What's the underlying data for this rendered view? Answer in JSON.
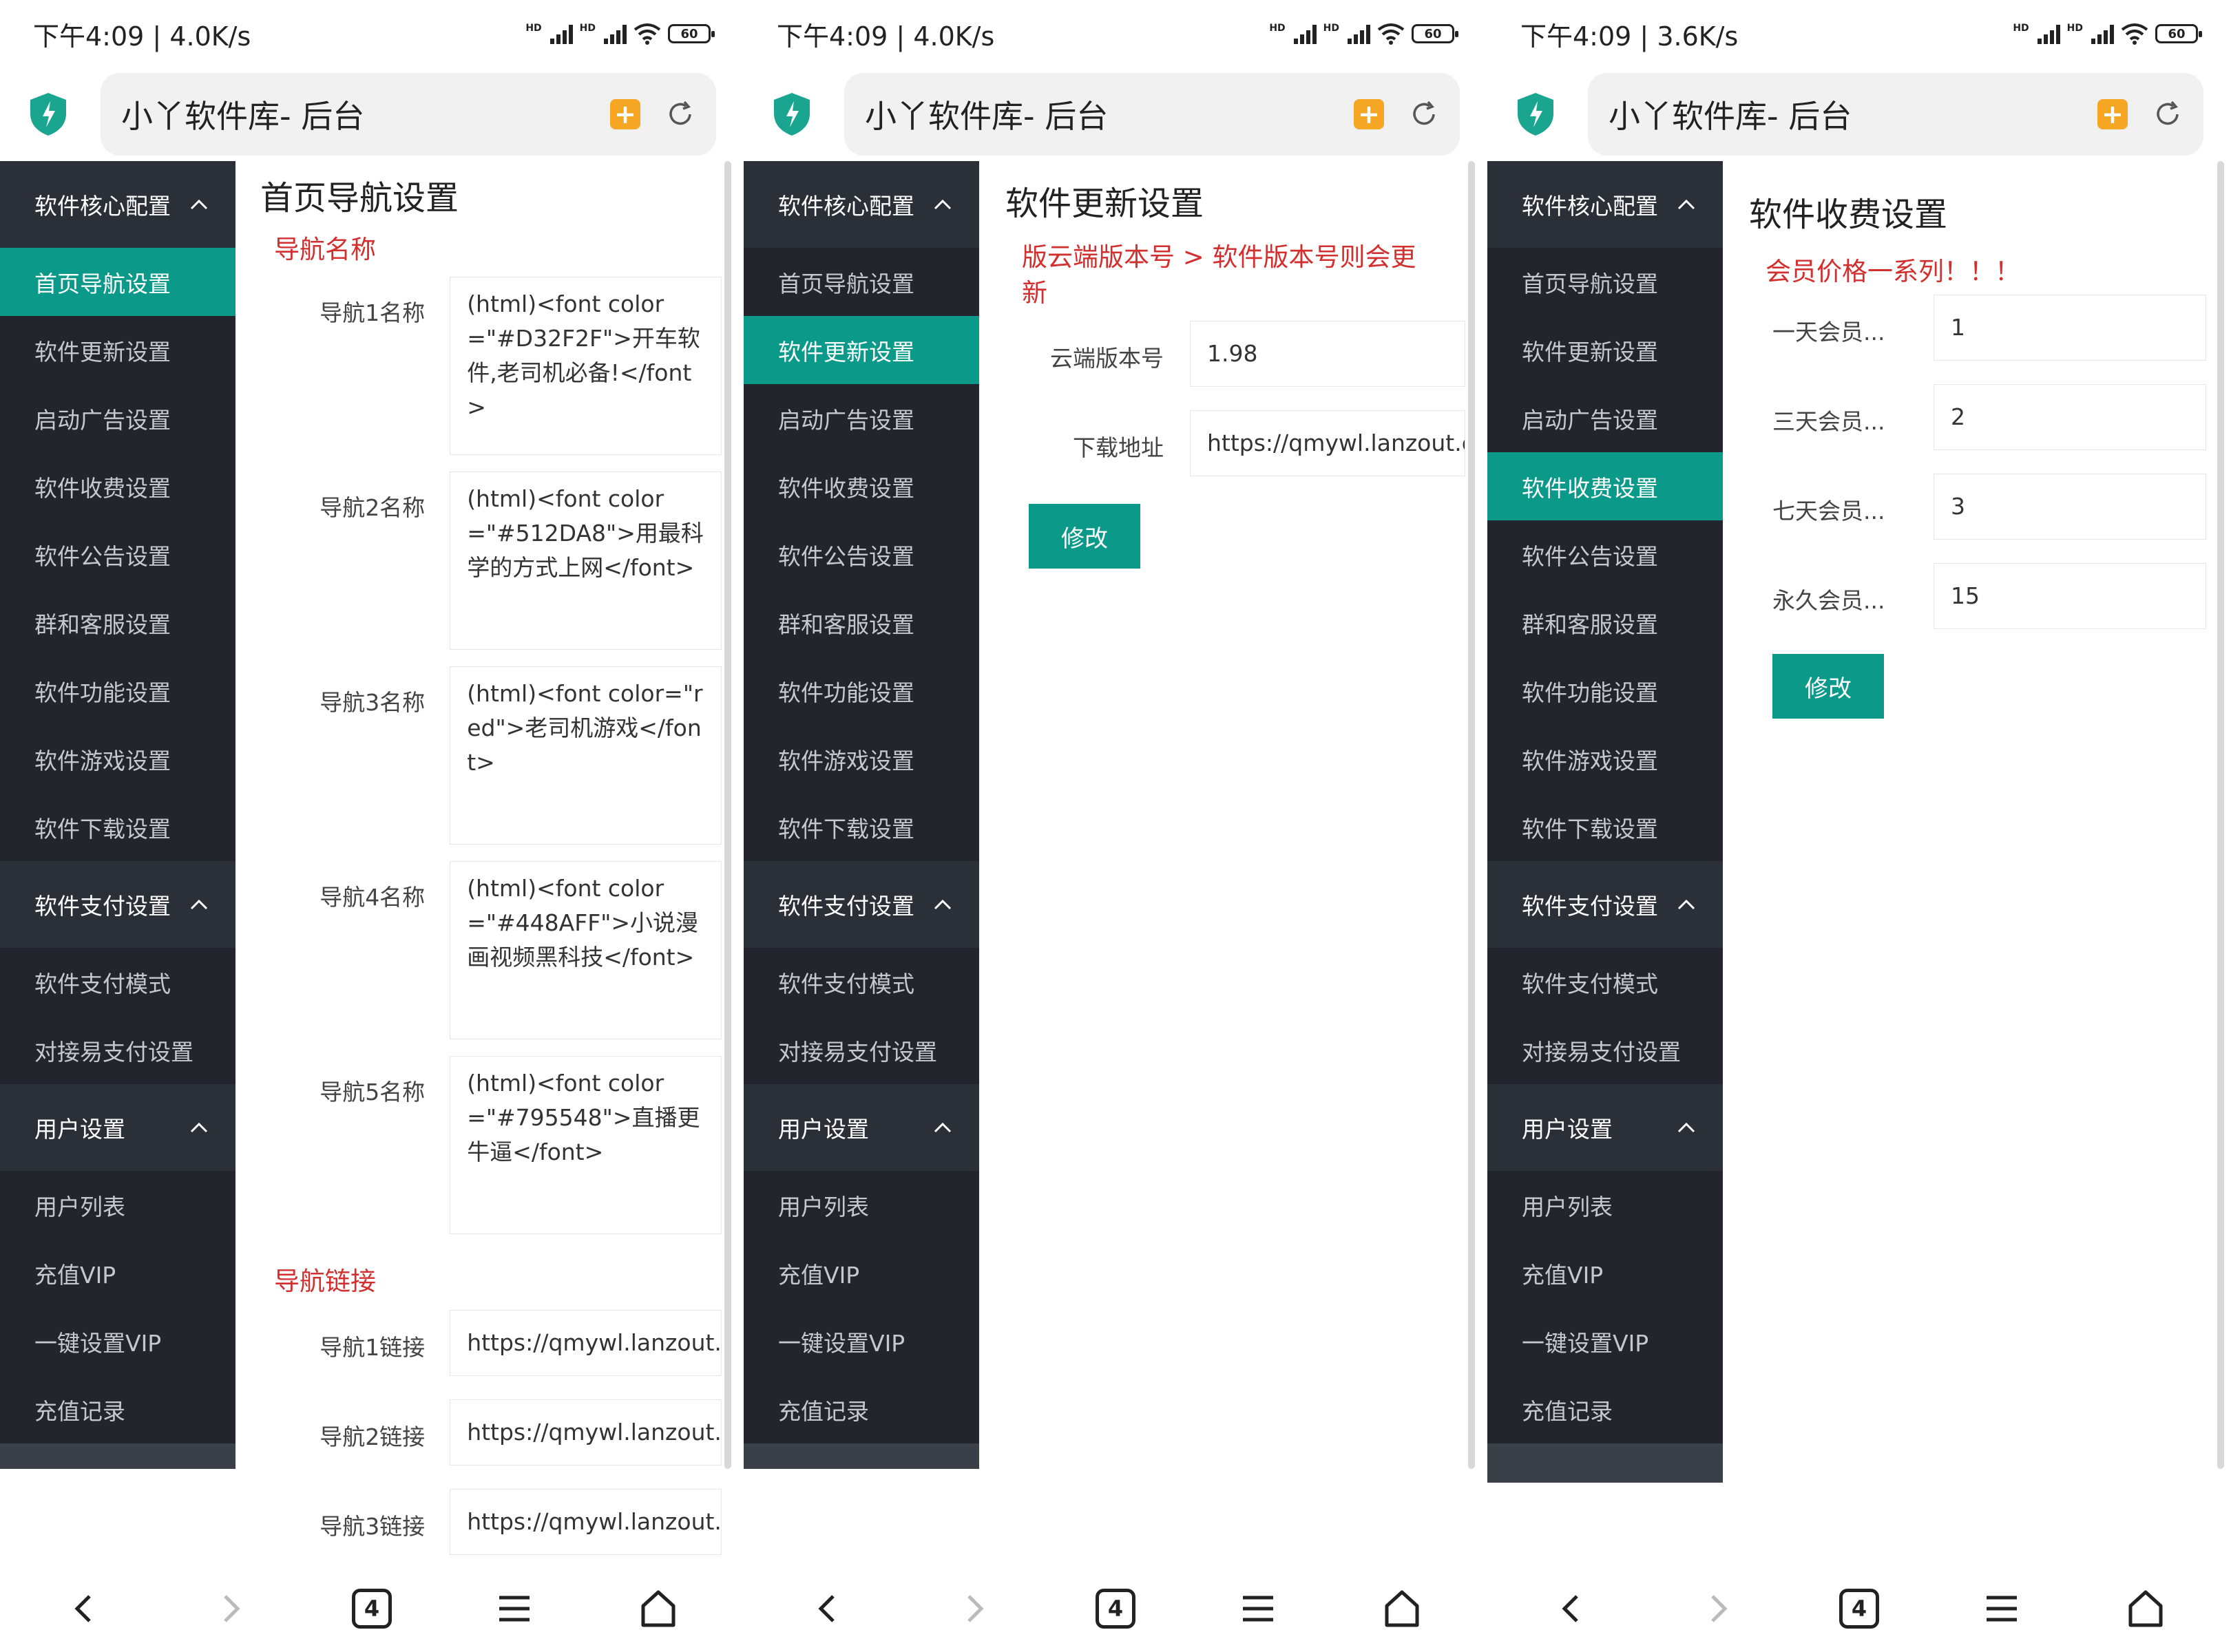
{
  "screens": [
    {
      "status": {
        "time": "下午4:09",
        "speed": "4.0K/s",
        "battery": "60"
      },
      "url_title": "小丫软件库- 后台",
      "sidebar": {
        "groups": [
          {
            "label": "软件核心配置",
            "items": [
              "首页导航设置",
              "软件更新设置",
              "启动广告设置",
              "软件收费设置",
              "软件公告设置",
              "群和客服设置",
              "软件功能设置",
              "软件游戏设置",
              "软件下载设置"
            ]
          },
          {
            "label": "软件支付设置",
            "items": [
              "软件支付模式",
              "对接易支付设置"
            ]
          },
          {
            "label": "用户设置",
            "items": [
              "用户列表",
              "充值VIP",
              "一键设置VIP",
              "充值记录"
            ]
          }
        ],
        "active": "首页导航设置"
      },
      "content": {
        "title": "首页导航设置",
        "section1": "导航名称",
        "names": [
          {
            "label": "导航1名称",
            "value": "(html)<font color=\"#D32F2F\">开车软件,老司机必备!</font>"
          },
          {
            "label": "导航2名称",
            "value": "(html)<font color=\"#512DA8\">用最科学的方式上网</font>"
          },
          {
            "label": "导航3名称",
            "value": "(html)<font color=\"red\">老司机游戏</font>"
          },
          {
            "label": "导航4名称",
            "value": "(html)<font color=\"#448AFF\">小说漫画视频黑科技</font>"
          },
          {
            "label": "导航5名称",
            "value": "(html)<font color=\"#795548\">直播更牛逼</font>"
          }
        ],
        "section2": "导航链接",
        "links": [
          {
            "label": "导航1链接",
            "value": "https://qmywl.lanzout.c"
          },
          {
            "label": "导航2链接",
            "value": "https://qmywl.lanzout.c"
          },
          {
            "label": "导航3链接",
            "value": "https://qmywl.lanzout.c"
          }
        ]
      }
    },
    {
      "status": {
        "time": "下午4:09",
        "speed": "4.0K/s",
        "battery": "60"
      },
      "url_title": "小丫软件库- 后台",
      "sidebar": {
        "groups": [
          {
            "label": "软件核心配置",
            "items": [
              "首页导航设置",
              "软件更新设置",
              "启动广告设置",
              "软件收费设置",
              "软件公告设置",
              "群和客服设置",
              "软件功能设置",
              "软件游戏设置",
              "软件下载设置"
            ]
          },
          {
            "label": "软件支付设置",
            "items": [
              "软件支付模式",
              "对接易支付设置"
            ]
          },
          {
            "label": "用户设置",
            "items": [
              "用户列表",
              "充值VIP",
              "一键设置VIP",
              "充值记录"
            ]
          }
        ],
        "active": "软件更新设置"
      },
      "content": {
        "title": "软件更新设置",
        "notice": "版云端版本号 > 软件版本号则会更新",
        "fields": [
          {
            "label": "云端版本号",
            "value": "1.98"
          },
          {
            "label": "下载地址",
            "value": "https://qmywl.lanzout.c"
          }
        ],
        "button": "修改"
      }
    },
    {
      "status": {
        "time": "下午4:09",
        "speed": "3.6K/s",
        "battery": "60"
      },
      "url_title": "小丫软件库- 后台",
      "sidebar": {
        "groups": [
          {
            "label": "软件核心配置",
            "items": [
              "首页导航设置",
              "软件更新设置",
              "启动广告设置",
              "软件收费设置",
              "软件公告设置",
              "群和客服设置",
              "软件功能设置",
              "软件游戏设置",
              "软件下载设置"
            ]
          },
          {
            "label": "软件支付设置",
            "items": [
              "软件支付模式",
              "对接易支付设置"
            ]
          },
          {
            "label": "用户设置",
            "items": [
              "用户列表",
              "充值VIP",
              "一键设置VIP",
              "充值记录"
            ]
          }
        ],
        "active": "软件收费设置"
      },
      "content": {
        "title": "软件收费设置",
        "notice": "会员价格一系列！！！",
        "fields": [
          {
            "label": "一天会员...",
            "value": "1"
          },
          {
            "label": "三天会员...",
            "value": "2"
          },
          {
            "label": "七天会员...",
            "value": "3"
          },
          {
            "label": "永久会员...",
            "value": "15"
          }
        ],
        "button": "修改"
      }
    }
  ],
  "navbar": {
    "tabs_count": "4"
  },
  "icons": {
    "shield": "shield-icon",
    "bookmark": "bookmark-icon",
    "refresh": "refresh-icon",
    "back": "back-icon",
    "forward": "forward-icon",
    "tabs": "tabs-icon",
    "menu": "menu-icon",
    "home": "home-icon"
  },
  "colors": {
    "accent": "#0b9a89",
    "sidebar": "#3b3f48",
    "sidebar_group": "#2b2f38",
    "notice": "#d32f2f",
    "bookmark": "#f5a623",
    "shield": "#1aa591"
  }
}
